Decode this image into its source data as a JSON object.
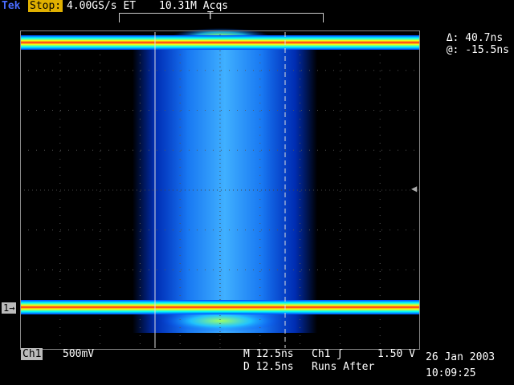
{
  "header": {
    "brand": "Tek",
    "state": "Stop:",
    "sample_rate": "4.00GS/s ET",
    "acquisitions": "10.31M Acqs",
    "trigger_marker": "T"
  },
  "cursor_readout": {
    "delta": "Δ: 40.7ns",
    "at": "@: -15.5ns"
  },
  "channel_marker": "1→",
  "footer": {
    "channel_label": "Ch1",
    "channel_scale": "500mV",
    "main_timebase": "M 12.5ns",
    "delayed_timebase": "D 12.5ns",
    "trigger_source": "Ch1 ʃ",
    "trigger_level": "1.50 V",
    "runs_mode": "Runs After",
    "date": "26 Jan 2003",
    "time": "10:09:25"
  },
  "colors": {
    "background": "#000000",
    "brand": "#4a6cff",
    "stop_badge": "#e0b000",
    "trace_hot": "#ff2020",
    "trace_warm": "#ffff00",
    "trace_mid": "#00ffff",
    "trace_cold": "#0040ff"
  }
}
